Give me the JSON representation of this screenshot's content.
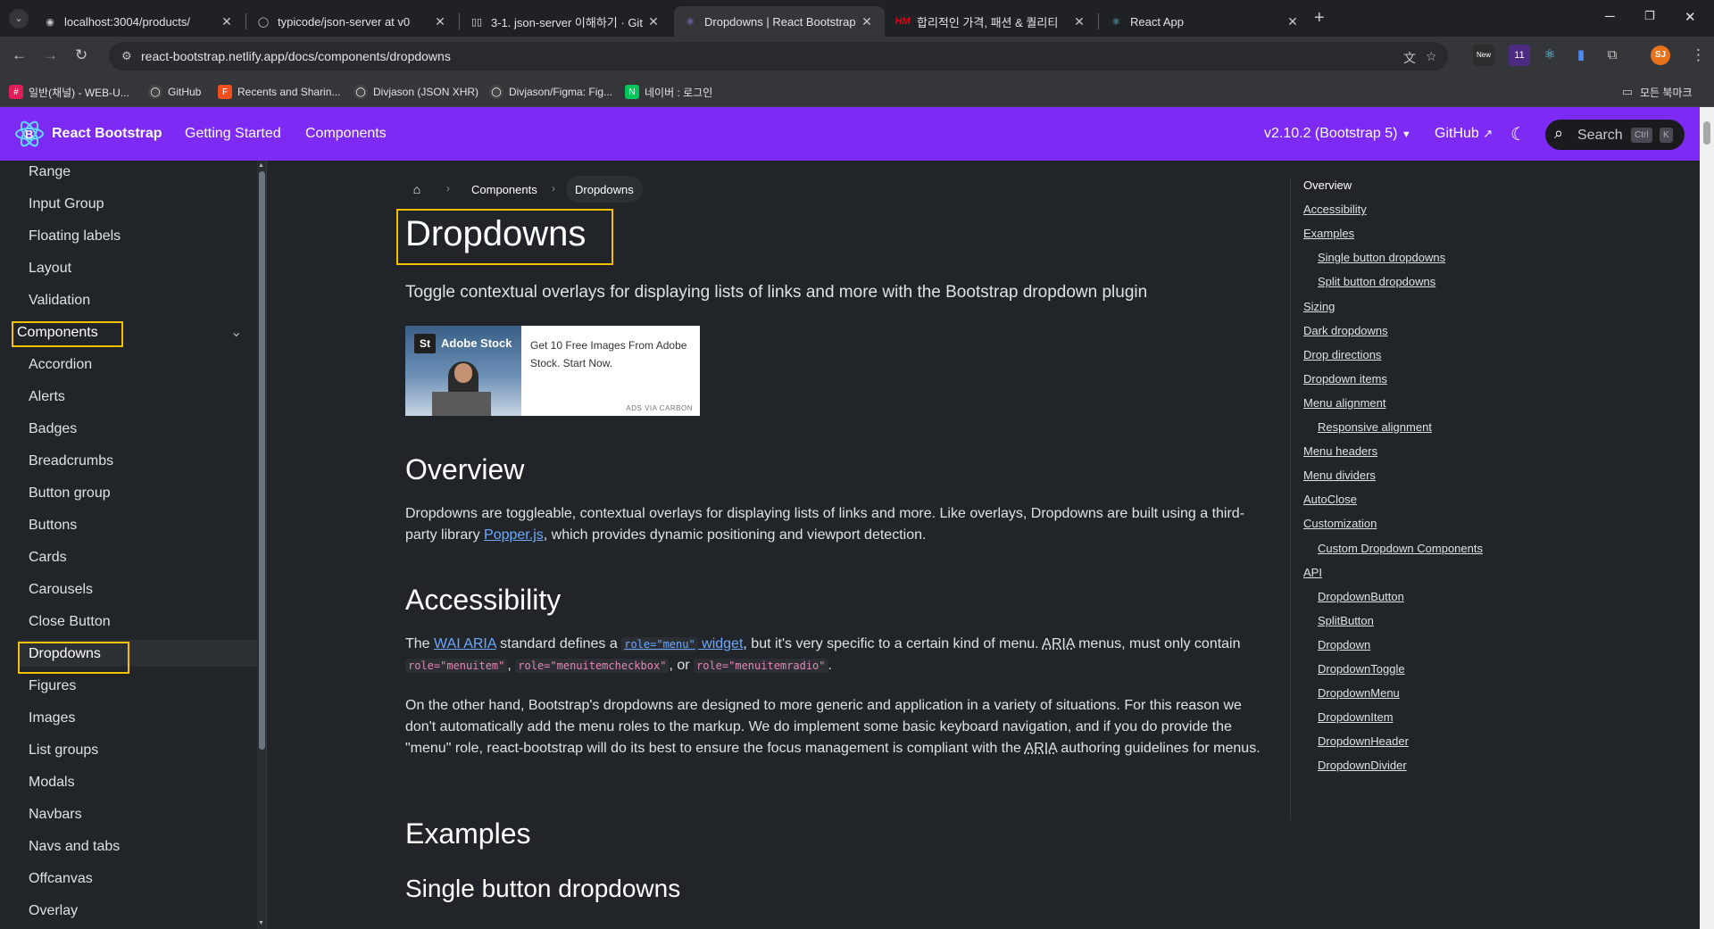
{
  "browser": {
    "tabs": [
      {
        "title": "localhost:3004/products/",
        "icon": "globe-icon"
      },
      {
        "title": "typicode/json-server at v0",
        "icon": "github-icon"
      },
      {
        "title": "3-1. json-server 이해하기 · Git",
        "icon": "gitbook-icon"
      },
      {
        "title": "Dropdowns | React Bootstrap",
        "icon": "react-bootstrap-icon",
        "active": true
      },
      {
        "title": "합리적인 가격, 패션 & 퀄리티",
        "icon": "hm-icon"
      },
      {
        "title": "React App",
        "icon": "react-icon"
      }
    ],
    "url": "react-bootstrap.netlify.app/docs/components/dropdowns",
    "bookmarks": [
      {
        "label": "일반(채널) - WEB-U...",
        "icon": "slack-icon",
        "color": "#e01e5a"
      },
      {
        "label": "GitHub",
        "icon": "github-icon",
        "color": "#444"
      },
      {
        "label": "Recents and Sharin...",
        "icon": "figma-icon",
        "color": "#f24e1e"
      },
      {
        "label": "Divjason (JSON XHR)",
        "icon": "github-icon",
        "color": "#444"
      },
      {
        "label": "Divjason/Figma: Fig...",
        "icon": "github-icon",
        "color": "#444"
      },
      {
        "label": "네이버 : 로그인",
        "icon": "naver-icon",
        "color": "#03c75a"
      }
    ],
    "all_bookmarks": "모든 북마크",
    "profile_initials": "SJ",
    "ext_badge": "11",
    "ext_new": "New"
  },
  "site": {
    "brand": "React Bootstrap",
    "nav": [
      "Getting Started",
      "Components"
    ],
    "version": "v2.10.2 (Bootstrap 5)",
    "github": "GitHub",
    "search": {
      "label": "Search",
      "key1": "Ctrl",
      "key2": "K"
    },
    "accent": "#7d2af5"
  },
  "sidebar": {
    "items_top": [
      "Range",
      "Input Group",
      "Floating labels",
      "Layout",
      "Validation"
    ],
    "section": "Components",
    "items": [
      "Accordion",
      "Alerts",
      "Badges",
      "Breadcrumbs",
      "Button group",
      "Buttons",
      "Cards",
      "Carousels",
      "Close Button",
      "Dropdowns",
      "Figures",
      "Images",
      "List groups",
      "Modals",
      "Navbars",
      "Navs and tabs",
      "Offcanvas",
      "Overlay"
    ],
    "active": "Dropdowns"
  },
  "main": {
    "breadcrumb": [
      "Components",
      "Dropdowns"
    ],
    "title": "Dropdowns",
    "lead": "Toggle contextual overlays for displaying lists of links and more with the Bootstrap dropdown plugin",
    "ad": {
      "brand": "Adobe Stock",
      "text": "Get 10 Free Images From Adobe Stock. Start Now.",
      "via": "ADS VIA CARBON"
    },
    "overview": {
      "heading": "Overview",
      "p1a": "Dropdowns are toggleable, contextual overlays for displaying lists of links and more. Like overlays, Dropdowns are built using a third-party library ",
      "link": "Popper.js",
      "p1b": ", which provides dynamic positioning and viewport detection."
    },
    "accessibility": {
      "heading": "Accessibility",
      "t1": "The ",
      "wai": "WAI ARIA",
      "t2": " standard defines a ",
      "role_menu": "role=\"menu\"",
      "widget": " widget",
      "t3": ", but it's very specific to a certain kind of menu. ",
      "aria": "ARIA",
      "t4": " menus, must only contain ",
      "c1": "role=\"menuitem\"",
      "sep": ", ",
      "c2": "role=\"menuitemcheckbox\"",
      "or": ", or ",
      "c3": "role=\"menuitemradio\"",
      "dot": ".",
      "p2a": "On the other hand, Bootstrap's dropdowns are designed to more generic and application in a variety of situations. For this reason we don't automatically add the menu roles to the markup. We do implement some basic keyboard navigation, and if you do provide the \"menu\" role, react-bootstrap will do its best to ensure the focus management is compliant with the ",
      "p2b": " authoring guidelines for menus."
    },
    "examples": "Examples",
    "single": "Single button dropdowns"
  },
  "toc": [
    {
      "label": "Overview",
      "level": 0
    },
    {
      "label": "Accessibility",
      "level": 0
    },
    {
      "label": "Examples",
      "level": 0
    },
    {
      "label": "Single button dropdowns",
      "level": 1
    },
    {
      "label": "Split button dropdowns",
      "level": 1
    },
    {
      "label": "Sizing",
      "level": 0
    },
    {
      "label": "Dark dropdowns",
      "level": 0
    },
    {
      "label": "Drop directions",
      "level": 0
    },
    {
      "label": "Dropdown items",
      "level": 0
    },
    {
      "label": "Menu alignment",
      "level": 0
    },
    {
      "label": "Responsive alignment",
      "level": 1
    },
    {
      "label": "Menu headers",
      "level": 0
    },
    {
      "label": "Menu dividers",
      "level": 0
    },
    {
      "label": "AutoClose",
      "level": 0
    },
    {
      "label": "Customization",
      "level": 0
    },
    {
      "label": "Custom Dropdown Components",
      "level": 1
    },
    {
      "label": "API",
      "level": 0
    },
    {
      "label": "DropdownButton",
      "level": 1
    },
    {
      "label": "SplitButton",
      "level": 1
    },
    {
      "label": "Dropdown",
      "level": 1
    },
    {
      "label": "DropdownToggle",
      "level": 1
    },
    {
      "label": "DropdownMenu",
      "level": 1
    },
    {
      "label": "DropdownItem",
      "level": 1
    },
    {
      "label": "DropdownHeader",
      "level": 1
    },
    {
      "label": "DropdownDivider",
      "level": 1
    }
  ]
}
